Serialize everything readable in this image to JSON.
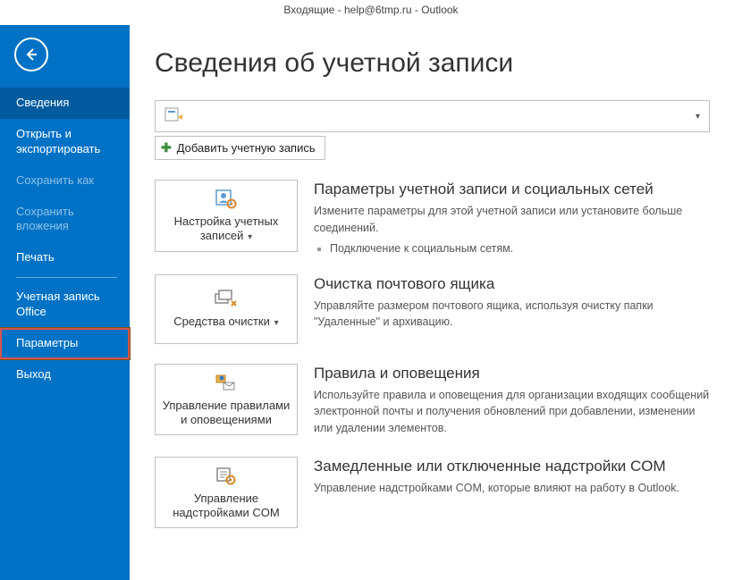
{
  "title_bar": "Входящие - help@6tmp.ru - Outlook",
  "page_title": "Сведения об учетной записи",
  "add_account_label": "Добавить учетную запись",
  "sidebar": {
    "items": [
      {
        "label": "Сведения",
        "active": true
      },
      {
        "label": "Открыть и экспортировать"
      },
      {
        "label": "Сохранить как",
        "disabled": true
      },
      {
        "label": "Сохранить вложения",
        "disabled": true
      },
      {
        "label": "Печать"
      },
      {
        "sep": true
      },
      {
        "label": "Учетная запись Office"
      },
      {
        "label": "Параметры",
        "highlighted": true
      },
      {
        "label": "Выход"
      }
    ]
  },
  "options": [
    {
      "button_label": "Настройка учетных записей",
      "has_dropdown": true,
      "heading": "Параметры учетной записи и социальных сетей",
      "desc": "Измените параметры для этой учетной записи или установите больше соединений.",
      "bullet": "Подключение к социальным сетям.",
      "icon": "person-gear-icon"
    },
    {
      "button_label": "Средства очистки",
      "has_dropdown": true,
      "heading": "Очистка почтового ящика",
      "desc": "Управляйте размером почтового ящика, используя очистку папки \"Удаленные\" и архивацию.",
      "icon": "cleanup-icon"
    },
    {
      "button_label": "Управление правилами и оповещениями",
      "has_dropdown": false,
      "heading": "Правила и оповещения",
      "desc": "Используйте правила и оповещения для организации входящих сообщений электронной почты и получения обновлений при добавлении, изменении или удалении элементов.",
      "icon": "rules-icon"
    },
    {
      "button_label": "Управление надстройками COM",
      "has_dropdown": false,
      "heading": "Замедленные или отключенные надстройки COM",
      "desc": "Управление надстройками COM, которые влияют на работу в Outlook.",
      "icon": "addins-icon"
    }
  ]
}
